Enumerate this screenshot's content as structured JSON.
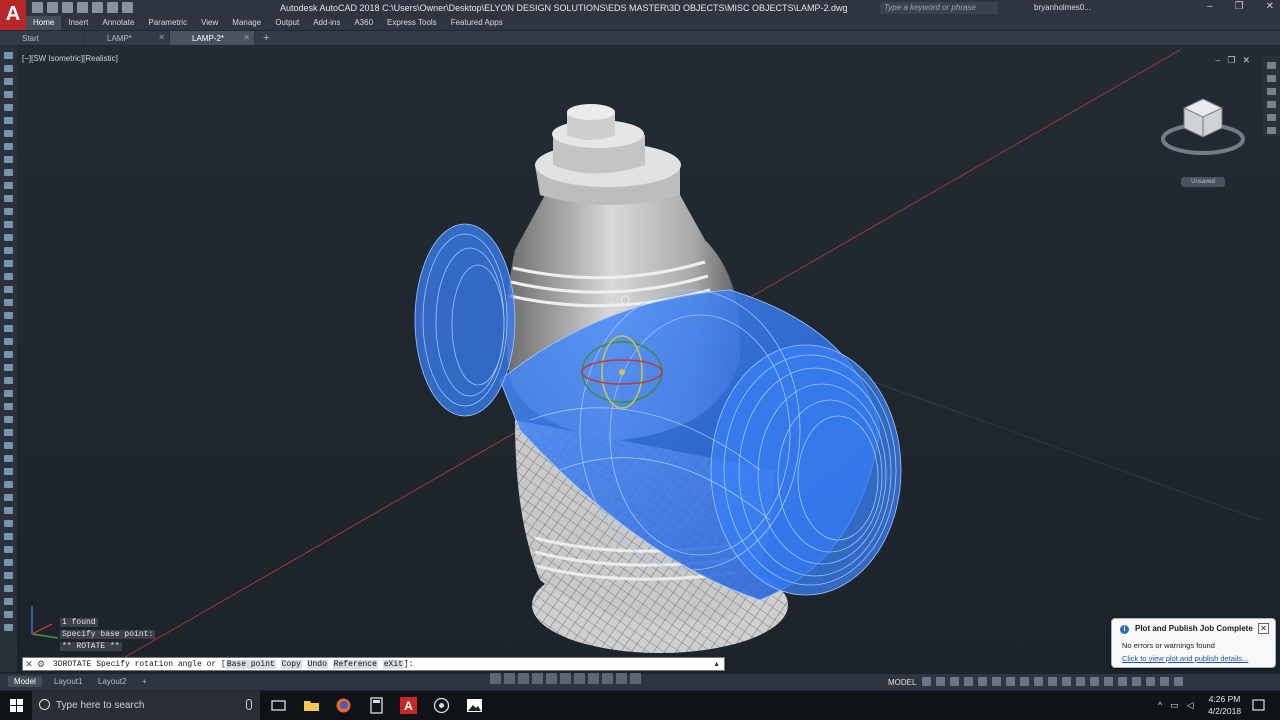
{
  "app": {
    "window_title": "Autodesk AutoCAD 2018    C:\\Users\\Owner\\Desktop\\ELYON DESIGN SOLUTIONS\\EDS MASTER\\3D OBJECTS\\MISC OBJECTS\\LAMP-2.dwg",
    "logo_letter": "A",
    "search_placeholder": "Type a keyword or phrase",
    "user_name": "bryanholmes0...",
    "window_controls": [
      "–",
      "❐",
      "✕"
    ]
  },
  "ribbon_tabs": [
    "Home",
    "Insert",
    "Annotate",
    "Parametric",
    "View",
    "Manage",
    "Output",
    "Add-ins",
    "A360",
    "Express Tools",
    "Featured Apps"
  ],
  "file_tabs": [
    {
      "label": "Start",
      "active": false
    },
    {
      "label": "LAMP*",
      "active": false
    },
    {
      "label": "LAMP-2*",
      "active": true
    }
  ],
  "file_tab_add": "+",
  "viewport": {
    "label": "[−][SW Isometric][Realistic]",
    "controls": [
      "–",
      "❐",
      "✕"
    ],
    "viewcube_unsaved": "Unsaved"
  },
  "command": {
    "history": [
      "1 found",
      "Specify base point:",
      "** ROTATE **"
    ],
    "prompt_prefix": "3DROTATE Specify rotation angle or [",
    "options": [
      "Base point",
      "Copy",
      "Undo",
      "Reference",
      "eXit"
    ],
    "prompt_suffix": "]:",
    "close_glyph": "✕",
    "wrench_glyph": "⚙"
  },
  "layout_tabs": [
    {
      "label": "Model",
      "active": true
    },
    {
      "label": "Layout1",
      "active": false
    },
    {
      "label": "Layout2",
      "active": false
    }
  ],
  "layout_add": "+",
  "status": {
    "mode": "MODEL"
  },
  "notification": {
    "title": "Plot and Publish Job Complete",
    "message": "No errors or warnings found",
    "link": "Click to view plot and publish details..."
  },
  "taskbar": {
    "search_placeholder": "Type here to search",
    "time": "4:26 PM",
    "date": "4/2/2018"
  },
  "colors": {
    "brand_red": "#b8272a",
    "viewport_bg": "#222a33",
    "selection_blue": "#2f7fff"
  }
}
